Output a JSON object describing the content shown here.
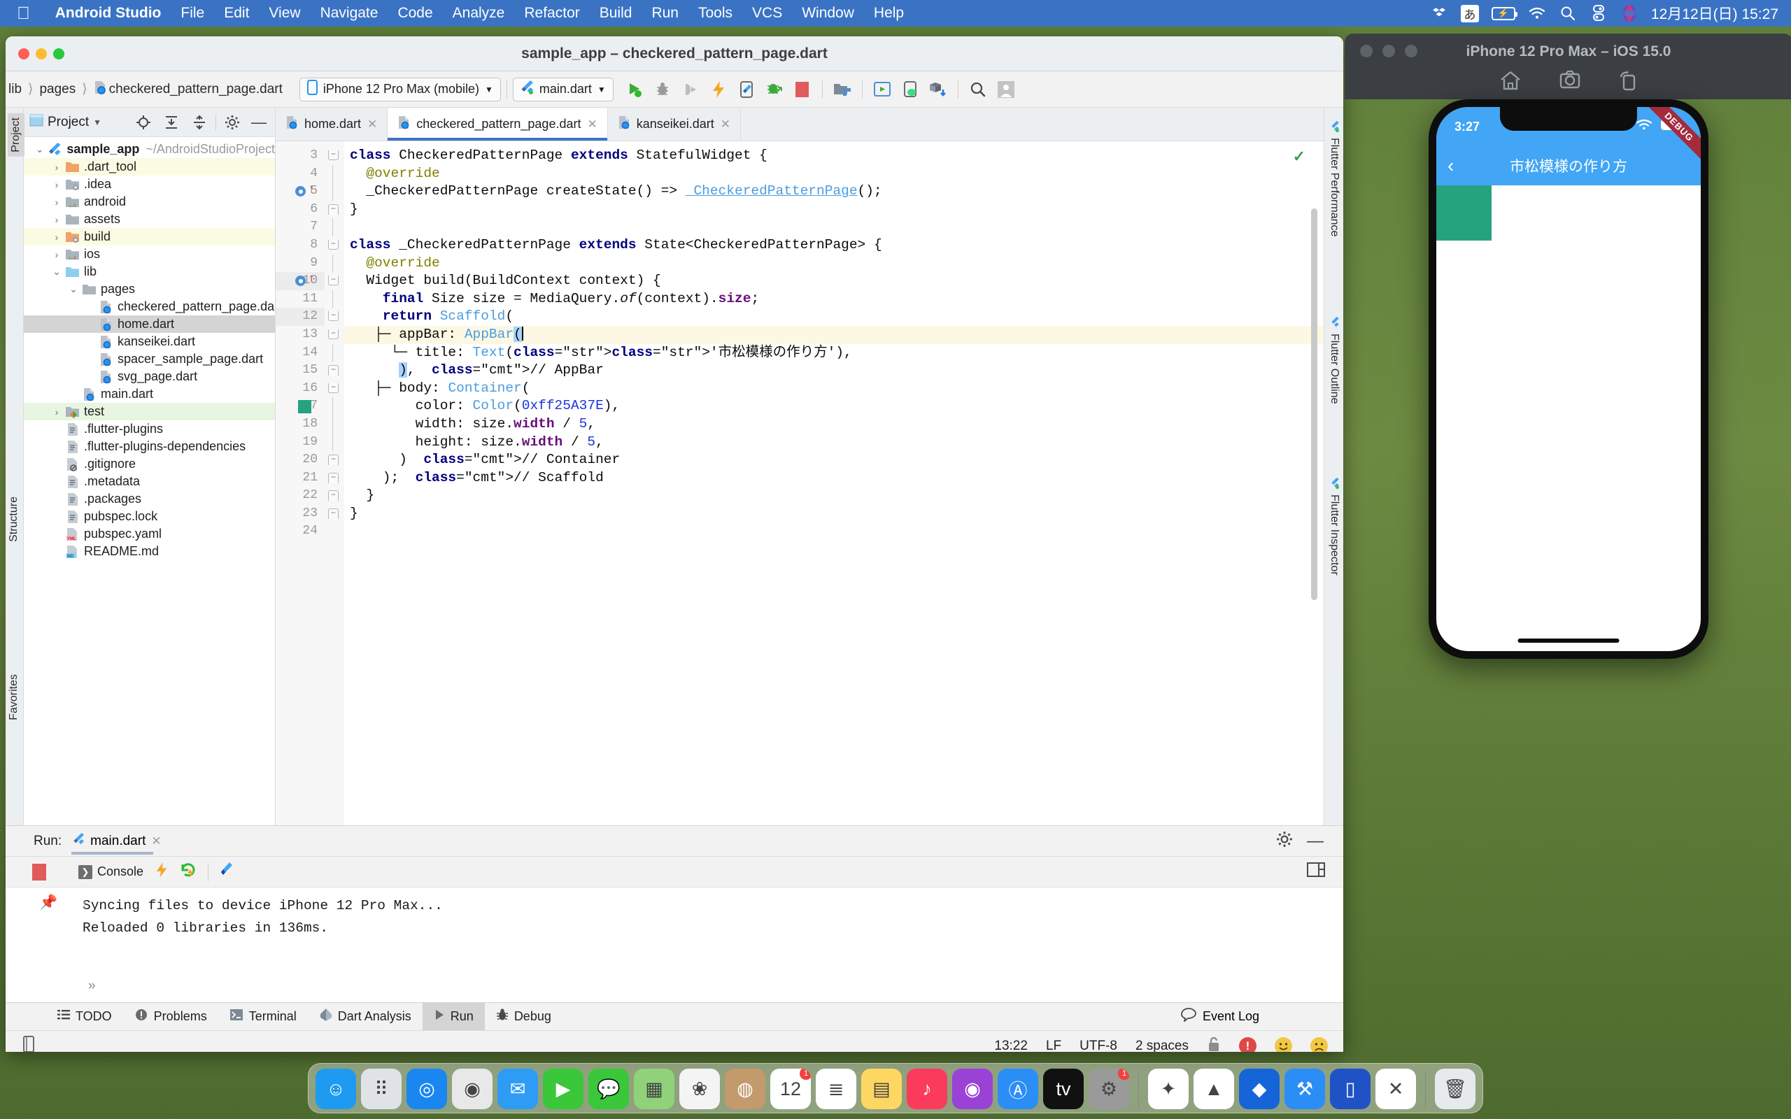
{
  "menubar": {
    "apple": "",
    "items": [
      "Android Studio",
      "File",
      "Edit",
      "View",
      "Navigate",
      "Code",
      "Analyze",
      "Refactor",
      "Build",
      "Run",
      "Tools",
      "VCS",
      "Window",
      "Help"
    ],
    "ime": "あ",
    "clock": "12月12日(日)  15:27"
  },
  "window": {
    "title": "sample_app – checkered_pattern_page.dart"
  },
  "navbar": {
    "breadcrumb": [
      "lib",
      "pages",
      "checkered_pattern_page.dart"
    ],
    "device": "iPhone 12 Pro Max (mobile)",
    "config": "main.dart"
  },
  "project": {
    "panel_label": "Project",
    "left_tabs": [
      "Project",
      "Structure",
      "Favorites"
    ],
    "tree": [
      {
        "depth": 0,
        "arrow": "v",
        "icon": "flutter",
        "name": "sample_app",
        "path": "~/AndroidStudioProject",
        "bold": true,
        "hl": ""
      },
      {
        "depth": 1,
        "arrow": ">",
        "icon": "folder-orange",
        "name": ".dart_tool",
        "path": "",
        "bold": false,
        "hl": "yellow"
      },
      {
        "depth": 1,
        "arrow": ">",
        "icon": "folder-idea",
        "name": ".idea",
        "path": "",
        "bold": false,
        "hl": ""
      },
      {
        "depth": 1,
        "arrow": ">",
        "icon": "folder-android",
        "name": "android",
        "path": "",
        "bold": false,
        "hl": ""
      },
      {
        "depth": 1,
        "arrow": ">",
        "icon": "folder-gray",
        "name": "assets",
        "path": "",
        "bold": false,
        "hl": ""
      },
      {
        "depth": 1,
        "arrow": ">",
        "icon": "folder-orange-idea",
        "name": "build",
        "path": "",
        "bold": false,
        "hl": "yellow"
      },
      {
        "depth": 1,
        "arrow": ">",
        "icon": "folder-android",
        "name": "ios",
        "path": "",
        "bold": false,
        "hl": ""
      },
      {
        "depth": 1,
        "arrow": "v",
        "icon": "folder-blue",
        "name": "lib",
        "path": "",
        "bold": false,
        "hl": ""
      },
      {
        "depth": 2,
        "arrow": "v",
        "icon": "folder-gray",
        "name": "pages",
        "path": "",
        "bold": false,
        "hl": ""
      },
      {
        "depth": 3,
        "arrow": "",
        "icon": "dart",
        "name": "checkered_pattern_page.da",
        "path": "",
        "bold": false,
        "hl": ""
      },
      {
        "depth": 3,
        "arrow": "",
        "icon": "dart",
        "name": "home.dart",
        "path": "",
        "bold": false,
        "hl": "sel"
      },
      {
        "depth": 3,
        "arrow": "",
        "icon": "dart",
        "name": "kanseikei.dart",
        "path": "",
        "bold": false,
        "hl": ""
      },
      {
        "depth": 3,
        "arrow": "",
        "icon": "dart",
        "name": "spacer_sample_page.dart",
        "path": "",
        "bold": false,
        "hl": ""
      },
      {
        "depth": 3,
        "arrow": "",
        "icon": "dart",
        "name": "svg_page.dart",
        "path": "",
        "bold": false,
        "hl": ""
      },
      {
        "depth": 2,
        "arrow": "",
        "icon": "dart",
        "name": "main.dart",
        "path": "",
        "bold": false,
        "hl": ""
      },
      {
        "depth": 1,
        "arrow": ">",
        "icon": "folder-test",
        "name": "test",
        "path": "",
        "bold": false,
        "hl": "green"
      },
      {
        "depth": 1,
        "arrow": "",
        "icon": "txt",
        "name": ".flutter-plugins",
        "path": "",
        "bold": false,
        "hl": ""
      },
      {
        "depth": 1,
        "arrow": "",
        "icon": "txt",
        "name": ".flutter-plugins-dependencies",
        "path": "",
        "bold": false,
        "hl": ""
      },
      {
        "depth": 1,
        "arrow": "",
        "icon": "ignore",
        "name": ".gitignore",
        "path": "",
        "bold": false,
        "hl": ""
      },
      {
        "depth": 1,
        "arrow": "",
        "icon": "txt",
        "name": ".metadata",
        "path": "",
        "bold": false,
        "hl": ""
      },
      {
        "depth": 1,
        "arrow": "",
        "icon": "txt",
        "name": ".packages",
        "path": "",
        "bold": false,
        "hl": ""
      },
      {
        "depth": 1,
        "arrow": "",
        "icon": "txt",
        "name": "pubspec.lock",
        "path": "",
        "bold": false,
        "hl": ""
      },
      {
        "depth": 1,
        "arrow": "",
        "icon": "yml",
        "name": "pubspec.yaml",
        "path": "",
        "bold": false,
        "hl": ""
      },
      {
        "depth": 1,
        "arrow": "",
        "icon": "md",
        "name": "README.md",
        "path": "",
        "bold": false,
        "hl": ""
      }
    ]
  },
  "editor": {
    "tabs": [
      {
        "label": "home.dart",
        "active": false
      },
      {
        "label": "checkered_pattern_page.dart",
        "active": true
      },
      {
        "label": "kanseikei.dart",
        "active": false
      }
    ],
    "first_line_number": 3,
    "lines": [
      {
        "n": 3,
        "text": "class CheckeredPatternPage extends StatefulWidget {"
      },
      {
        "n": 4,
        "text": "  @override"
      },
      {
        "n": 5,
        "text": "  _CheckeredPatternPage createState() => _CheckeredPatternPage();"
      },
      {
        "n": 6,
        "text": "}"
      },
      {
        "n": 7,
        "text": ""
      },
      {
        "n": 8,
        "text": "class _CheckeredPatternPage extends State<CheckeredPatternPage> {"
      },
      {
        "n": 9,
        "text": "  @override"
      },
      {
        "n": 10,
        "text": "  Widget build(BuildContext context) {"
      },
      {
        "n": 11,
        "text": "    final Size size = MediaQuery.of(context).size;"
      },
      {
        "n": 12,
        "text": "    return Scaffold("
      },
      {
        "n": 13,
        "text": "      appBar: AppBar("
      },
      {
        "n": 14,
        "text": "        title: Text('市松模様の作り方'),"
      },
      {
        "n": 15,
        "text": "      ),  // AppBar"
      },
      {
        "n": 16,
        "text": "      body: Container("
      },
      {
        "n": 17,
        "text": "        color: Color(0xff25A37E),"
      },
      {
        "n": 18,
        "text": "        width: size.width / 5,"
      },
      {
        "n": 19,
        "text": "        height: size.width / 5,"
      },
      {
        "n": 20,
        "text": "      )  // Container"
      },
      {
        "n": 21,
        "text": "    );  // Scaffold"
      },
      {
        "n": 22,
        "text": "  }"
      },
      {
        "n": 23,
        "text": "}"
      },
      {
        "n": 24,
        "text": ""
      }
    ],
    "current_line": 13,
    "color_swatch_line": 17,
    "color_swatch_hex": "#25A37E",
    "gutter_run_lines": [
      5,
      10
    ]
  },
  "right_tabs": [
    "Flutter Performance",
    "Flutter Outline",
    "Flutter Inspector"
  ],
  "run_panel": {
    "label": "Run:",
    "tab": "main.dart",
    "console_label": "Console",
    "output": [
      "Syncing files to device iPhone 12 Pro Max...",
      "Reloaded 0 libraries in 136ms."
    ]
  },
  "tool_windows": [
    {
      "label": "TODO",
      "icon": "list-icon",
      "selected": false
    },
    {
      "label": "Problems",
      "icon": "problems-icon",
      "selected": false
    },
    {
      "label": "Terminal",
      "icon": "terminal-icon",
      "selected": false
    },
    {
      "label": "Dart Analysis",
      "icon": "dart-icon",
      "selected": false
    },
    {
      "label": "Run",
      "icon": "play-icon",
      "selected": true
    },
    {
      "label": "Debug",
      "icon": "bug-icon",
      "selected": false
    }
  ],
  "event_log": "Event Log",
  "statusbar": {
    "position": "13:22",
    "line_sep": "LF",
    "encoding": "UTF-8",
    "indent": "2 spaces"
  },
  "simulator": {
    "title": "iPhone 12 Pro Max – iOS 15.0",
    "toolbar_icons": [
      "home-icon",
      "camera-icon",
      "rotate-icon"
    ],
    "status_time": "3:27",
    "app_title": "市松模様の作り方",
    "debug_ribbon": "DEBUG",
    "appbar_color": "#42a5f5",
    "box_color": "#25A37E"
  },
  "dock": {
    "items": [
      {
        "name": "finder",
        "color": "#1e9bf0",
        "glyph": "☺"
      },
      {
        "name": "launchpad",
        "color": "#dfe3e8",
        "glyph": "⠿"
      },
      {
        "name": "safari",
        "color": "#1a86f0",
        "glyph": "◎"
      },
      {
        "name": "chrome",
        "color": "#e8e8e8",
        "glyph": "◉"
      },
      {
        "name": "mail",
        "color": "#2e9bf5",
        "glyph": "✉"
      },
      {
        "name": "facetime",
        "color": "#3ac73a",
        "glyph": "▶"
      },
      {
        "name": "messages",
        "color": "#3ac73a",
        "glyph": "💬"
      },
      {
        "name": "maps",
        "color": "#8fd27a",
        "glyph": "▦"
      },
      {
        "name": "photos",
        "color": "#f4f4f4",
        "glyph": "❀"
      },
      {
        "name": "contacts",
        "color": "#c39a6b",
        "glyph": "◍"
      },
      {
        "name": "calendar",
        "color": "#ffffff",
        "glyph": "12",
        "badge": "1"
      },
      {
        "name": "reminders",
        "color": "#ffffff",
        "glyph": "≣"
      },
      {
        "name": "notes",
        "color": "#fdd761",
        "glyph": "▤"
      },
      {
        "name": "music",
        "color": "#fb3b5c",
        "glyph": "♪"
      },
      {
        "name": "podcasts",
        "color": "#9a41d6",
        "glyph": "◉"
      },
      {
        "name": "app-store",
        "color": "#2b8df6",
        "glyph": "Ⓐ"
      },
      {
        "name": "apple-tv",
        "color": "#111111",
        "glyph": "tv"
      },
      {
        "name": "system-preferences",
        "color": "#9a9a9a",
        "glyph": "⚙",
        "badge": "1"
      },
      {
        "name": "slack",
        "color": "#ffffff",
        "glyph": "✦"
      },
      {
        "name": "android-studio",
        "color": "#ffffff",
        "glyph": "▲"
      },
      {
        "name": "flutter-tool",
        "color": "#1565d8",
        "glyph": "◆"
      },
      {
        "name": "xcode",
        "color": "#2b8df6",
        "glyph": "⚒"
      },
      {
        "name": "simulator",
        "color": "#1f53c5",
        "glyph": "▯"
      },
      {
        "name": "vscode",
        "color": "#ffffff",
        "glyph": "✕"
      },
      {
        "name": "trash",
        "color": "#e6eaec",
        "glyph": "🗑"
      }
    ]
  }
}
